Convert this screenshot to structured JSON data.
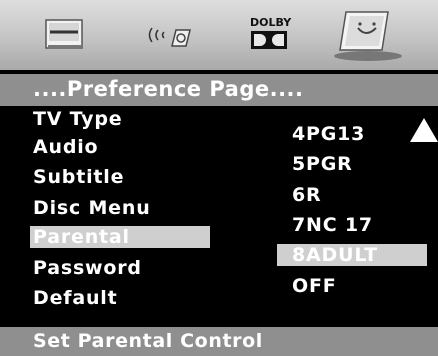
{
  "icon_bar": {
    "icons": [
      "general-setup-icon",
      "speaker-setup-icon",
      "dolby-icon",
      "preference-icon"
    ],
    "dolby_label": "DOLBY"
  },
  "header": {
    "title": "....Preference Page...."
  },
  "menu": {
    "items": [
      "TV Type",
      "Audio",
      "Subtitle",
      "Disc Menu",
      "Parental",
      "Password",
      "Default"
    ],
    "selected_index": 4
  },
  "options": {
    "items": [
      "4PG13",
      "5PGR",
      "6R",
      "7NC 17",
      "8ADULT",
      "OFF"
    ],
    "selected_index": 4
  },
  "footer": {
    "status": "Set Parental Control"
  },
  "colors": {
    "background": "#000000",
    "highlight": "#cfcfcf",
    "bar": "#8f8f8f",
    "text": "#ffffff"
  }
}
